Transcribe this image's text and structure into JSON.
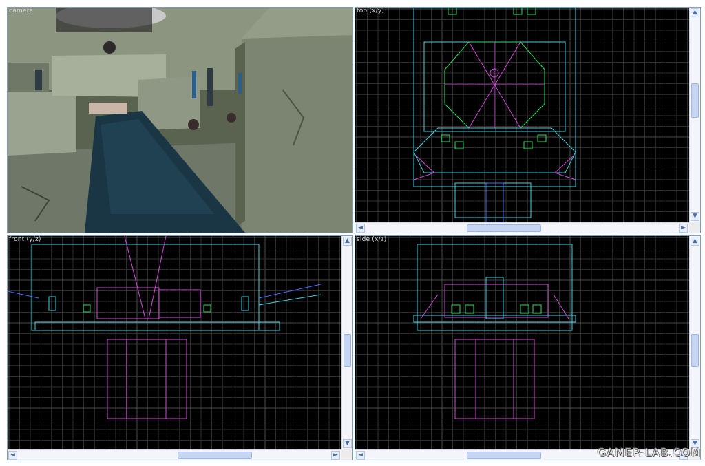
{
  "viewports": {
    "camera": {
      "label": "camera"
    },
    "top": {
      "label": "top (x/y)"
    },
    "front": {
      "label": "front (y/z)"
    },
    "side": {
      "label": "side (x/z)"
    }
  },
  "scroll": {
    "up_arrow": "▲",
    "down_arrow": "▼",
    "left_arrow": "◄",
    "right_arrow": "►",
    "grip": "|||"
  },
  "colors": {
    "grid_minor": "#2f2f2f",
    "grid_major": "#4a4a4a",
    "brush_magenta": "#d24ad8",
    "brush_cyan": "#3fd2e0",
    "brush_blue": "#4a6cff",
    "brush_green": "#2ce05a",
    "water": "#1a3644",
    "stone": "#7c8670"
  },
  "watermark": {
    "text": "GAMER-LAB.COM"
  }
}
